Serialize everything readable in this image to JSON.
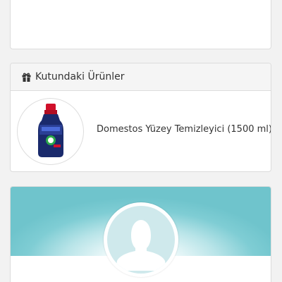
{
  "box_section": {
    "title": "Kutundaki Ürünler",
    "title_icon": "gift-icon",
    "products": [
      {
        "name": "Domestos Yüzey Temizleyici (1500 ml)",
        "image_icon": "detergent-bottle-icon"
      }
    ]
  },
  "profile_section": {
    "avatar_icon": "user-silhouette-icon"
  },
  "colors": {
    "banner_teal": "#6fc4cc",
    "avatar_bg": "#cfe9ec",
    "avatar_figure": "#ffffff",
    "bottle_blue": "#1a2a6c",
    "bottle_cap": "#d0102a"
  }
}
